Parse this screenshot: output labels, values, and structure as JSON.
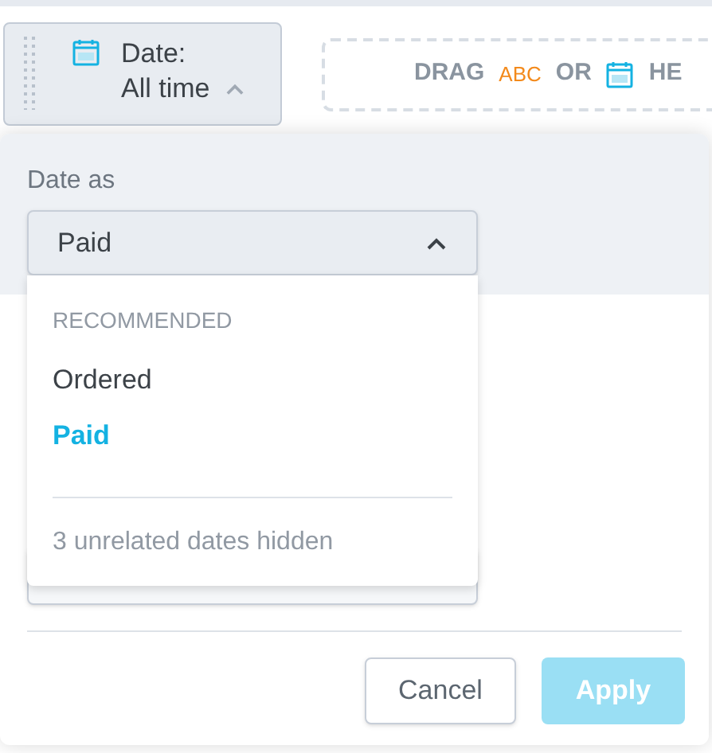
{
  "filter_button": {
    "label": "Date:",
    "value": "All time",
    "expanded": true
  },
  "drop_zone": {
    "parts": [
      {
        "kind": "text",
        "text": "DRAG"
      },
      {
        "kind": "attribute",
        "text": "ABC"
      },
      {
        "kind": "text",
        "text": "OR"
      },
      {
        "kind": "date"
      },
      {
        "kind": "text",
        "text": "HE"
      }
    ]
  },
  "date_as": {
    "label": "Date as",
    "value": "Paid",
    "expanded": true
  },
  "menu": {
    "heading": "RECOMMENDED",
    "items": [
      {
        "label": "Ordered",
        "selected": false
      },
      {
        "label": "Paid",
        "selected": true
      }
    ],
    "footer": "3 unrelated dates hidden"
  },
  "buttons": [
    {
      "label": "Cancel",
      "kind": "secondary",
      "disabled": false
    },
    {
      "label": "Apply",
      "kind": "primary",
      "disabled": true
    }
  ]
}
